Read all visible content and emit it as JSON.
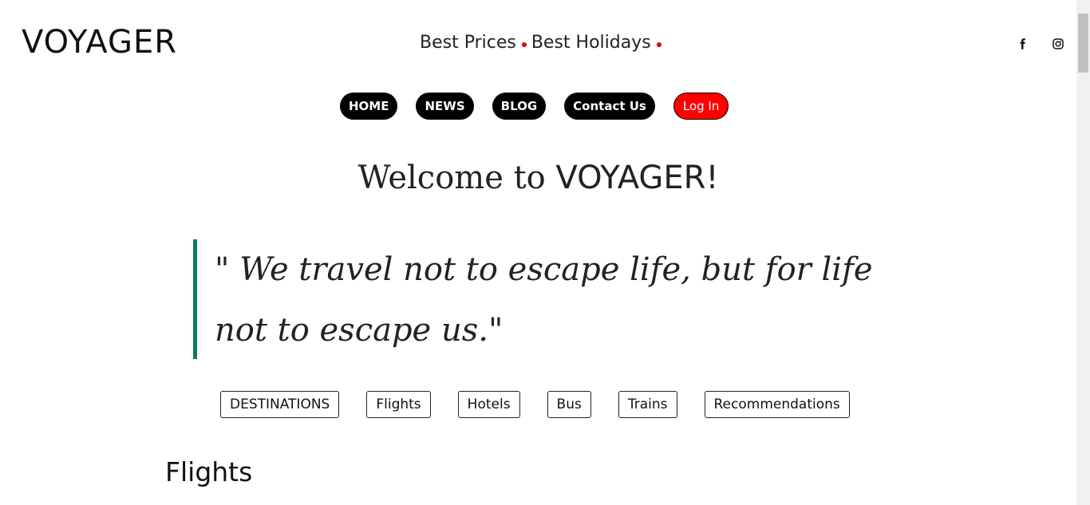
{
  "header": {
    "logo": "VOYAGER",
    "tagline_part1": "Best Prices",
    "tagline_part2": "Best Holidays",
    "social": {
      "facebook_icon": "f",
      "instagram_icon": "instagram"
    }
  },
  "nav": {
    "items": [
      {
        "label": "HOME"
      },
      {
        "label": "NEWS"
      },
      {
        "label": "BLOG"
      },
      {
        "label": "Contact Us"
      },
      {
        "label": "Log In"
      }
    ]
  },
  "hero": {
    "welcome_prefix": "Welcome to ",
    "welcome_brand": "VOYAGER!",
    "quote": "\" We travel not to escape life, but for life not to escape us.\""
  },
  "tabs": {
    "items": [
      {
        "label": "DESTINATIONS"
      },
      {
        "label": "Flights"
      },
      {
        "label": "Hotels"
      },
      {
        "label": "Bus"
      },
      {
        "label": "Trains"
      },
      {
        "label": "Recommendations"
      }
    ]
  },
  "section": {
    "title": "Flights"
  },
  "colors": {
    "accent_red": "#ff0000",
    "quote_border": "#0a7a6a"
  }
}
